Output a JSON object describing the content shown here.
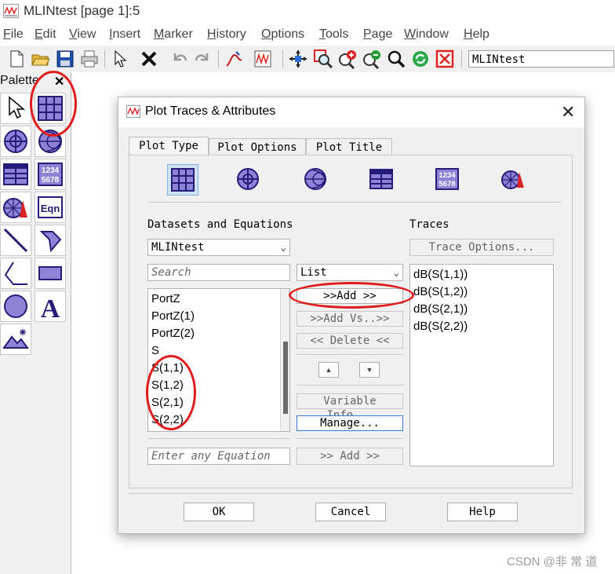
{
  "window": {
    "title": "MLINtest [page 1]:5"
  },
  "menu": [
    {
      "label": "File",
      "u": "F",
      "rest": "ile"
    },
    {
      "label": "Edit",
      "u": "E",
      "rest": "dit"
    },
    {
      "label": "View",
      "u": "V",
      "rest": "iew"
    },
    {
      "label": "Insert",
      "u": "I",
      "rest": "nsert"
    },
    {
      "label": "Marker",
      "u": "M",
      "rest": "arker"
    },
    {
      "label": "History",
      "u": "H",
      "rest": "istory"
    },
    {
      "label": "Options",
      "u": "O",
      "rest": "ptions"
    },
    {
      "label": "Tools",
      "u": "T",
      "rest": "ools"
    },
    {
      "label": "Page",
      "u": "P",
      "rest": "age"
    },
    {
      "label": "Window",
      "u": "W",
      "rest": "indow"
    },
    {
      "label": "Help",
      "u": "H",
      "rest": "elp"
    }
  ],
  "toolbar": {
    "dataset_value": "MLINtest"
  },
  "palette": {
    "title": "Palette",
    "close": "✕",
    "eqn_label": "Eqn",
    "num_label_1": "1234",
    "num_label_2": "5678",
    "text_label": "A"
  },
  "dialog": {
    "title": "Plot Traces & Attributes",
    "close": "✕",
    "tabs": [
      "Plot Type",
      "Plot Options",
      "Plot Title"
    ],
    "datasets_label": "Datasets and Equations",
    "traces_label": "Traces",
    "dataset_combo": "MLINtest",
    "search_placeholder": "Search",
    "list_combo": "List",
    "dataset_items": [
      "PortZ",
      "PortZ(1)",
      "PortZ(2)",
      "S",
      "S(1,1)",
      "S(1,2)",
      "S(2,1)",
      "S(2,2)"
    ],
    "traces_items": [
      "dB(S(1,1))",
      "dB(S(1,2))",
      "dB(S(2,1))",
      "dB(S(2,2))"
    ],
    "buttons": {
      "trace_options": "Trace Options...",
      "add": ">>Add >>",
      "add_vs": ">>Add Vs..>>",
      "delete": "<< Delete <<",
      "up": "▲",
      "down": "▼",
      "variable_info": "Variable Info...",
      "manage": "Manage...",
      "equation_add": ">> Add >>",
      "ok": "OK",
      "cancel": "Cancel",
      "help": "Help"
    },
    "equation_placeholder": "Enter any Equation",
    "num_icon_1": "1234",
    "num_icon_2": "5678"
  },
  "watermark": "CSDN @非 常 道"
}
